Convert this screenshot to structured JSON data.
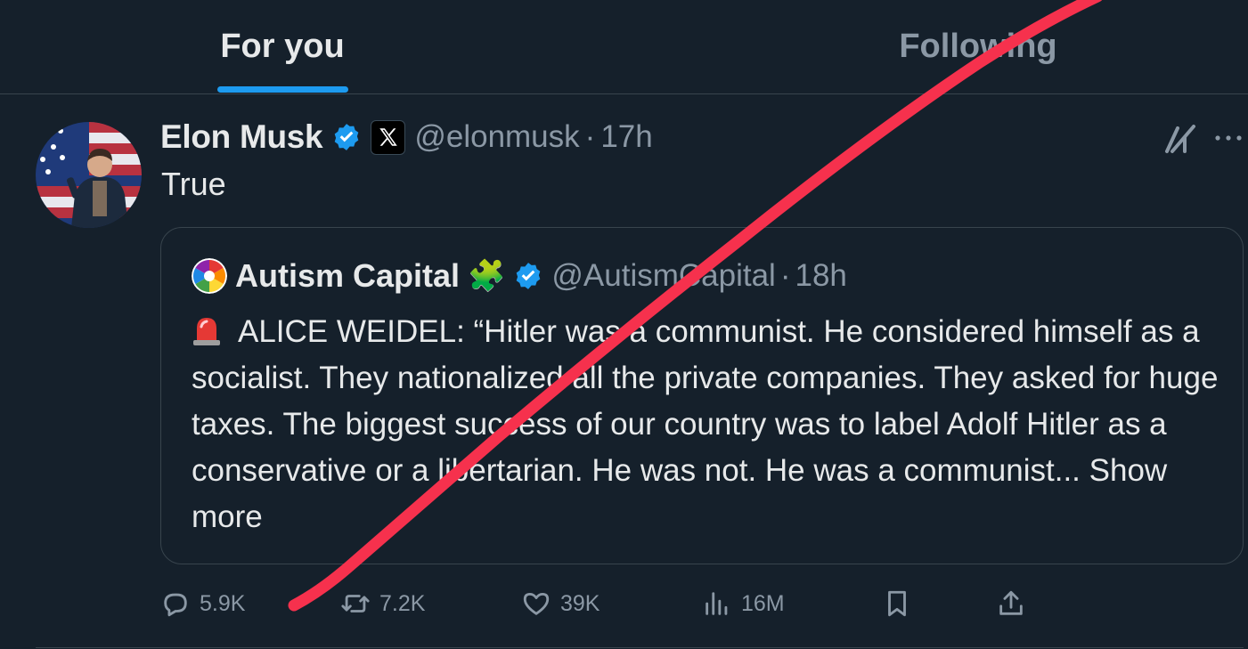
{
  "tabs": {
    "for_you": "For you",
    "following": "Following",
    "active": "for_you"
  },
  "tweet": {
    "author_name": "Elon Musk",
    "handle": "@elonmusk",
    "separator": "·",
    "time": "17h",
    "text": "True",
    "badges": [
      "verified-badge-icon",
      "x-affiliate-icon"
    ]
  },
  "quote": {
    "author_name": "Autism Capital",
    "name_emoji": "🧩",
    "handle": "@AutismCapital",
    "separator": "·",
    "time": "18h",
    "emoji": "siren-icon",
    "body": "ALICE WEIDEL: “Hitler was a communist. He considered himself as a socialist. They nationalized all the private companies. They asked for huge taxes. The biggest success of our country was to label Adolf Hitler as a conservative or a libertarian. He was not. He was a communist...",
    "show_more": "Show more"
  },
  "actions": {
    "replies": "5.9K",
    "reposts": "7.2K",
    "likes": "39K",
    "views": "16M"
  },
  "colors": {
    "background": "#15202b",
    "accent": "#1d9bf0",
    "secondary_text": "#8b98a5",
    "annotation_stroke": "#f6314d"
  }
}
